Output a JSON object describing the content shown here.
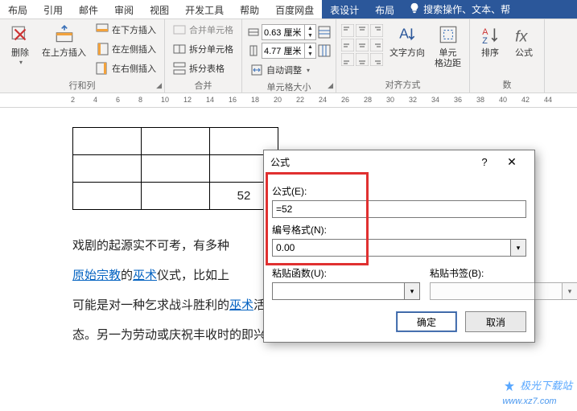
{
  "tabs": {
    "layout1": "布局",
    "references": "引用",
    "mailings": "邮件",
    "review": "审阅",
    "view": "视图",
    "devtools": "开发工具",
    "help": "帮助",
    "baidu": "百度网盘",
    "tabledesign": "表设计",
    "layout2": "布局",
    "tellme_placeholder": "搜索操作、文本、帮"
  },
  "rowcol": {
    "delete": "删除",
    "insert_above": "在上方插入",
    "insert_below": "在下方插入",
    "insert_left": "在左侧插入",
    "insert_right": "在右侧插入",
    "group_label": "行和列"
  },
  "merge": {
    "merge_cells": "合并单元格",
    "split_cells": "拆分单元格",
    "split_table": "拆分表格",
    "group_label": "合并"
  },
  "cellsize": {
    "height_value": "0.63 厘米",
    "width_value": "4.77 厘米",
    "autofit": "自动调整",
    "group_label": "单元格大小"
  },
  "align": {
    "text_direction": "文字方向",
    "cell_margins": "单元\n格边距",
    "group_label": "对齐方式"
  },
  "data_group": {
    "sort": "排序",
    "formula": "公式",
    "group_label": "数"
  },
  "ruler_marks": [
    "2",
    "4",
    "6",
    "8",
    "10",
    "12",
    "14",
    "16",
    "18",
    "20",
    "22",
    "24",
    "26",
    "28",
    "30",
    "32",
    "34",
    "36",
    "38",
    "40",
    "42",
    "44"
  ],
  "table_cell_value": "52",
  "doc_text": {
    "p1_a": "戏剧的起源实不可考，有多种",
    "p2_a": "原始宗教",
    "p2_b": "的",
    "p2_c": "巫术",
    "p2_d": "仪式，比如上",
    "p3_a": "可能是对一种乞求战斗胜利的",
    "p3_b": "巫术",
    "p3_c": "活动的合称，即戏剧的原始形",
    "p4": "态。另一为劳动或庆祝丰收时的即兴歌舞表演，这种说法主要依"
  },
  "dialog": {
    "title": "公式",
    "formula_label": "公式(E):",
    "formula_value": "=52",
    "numfmt_label": "编号格式(N):",
    "numfmt_value": "0.00",
    "paste_fn_label": "粘贴函数(U):",
    "paste_bm_label": "粘贴书签(B):",
    "ok": "确定",
    "cancel": "取消"
  },
  "watermark": {
    "text": "极光下载站",
    "url": "www.xz7.com"
  }
}
